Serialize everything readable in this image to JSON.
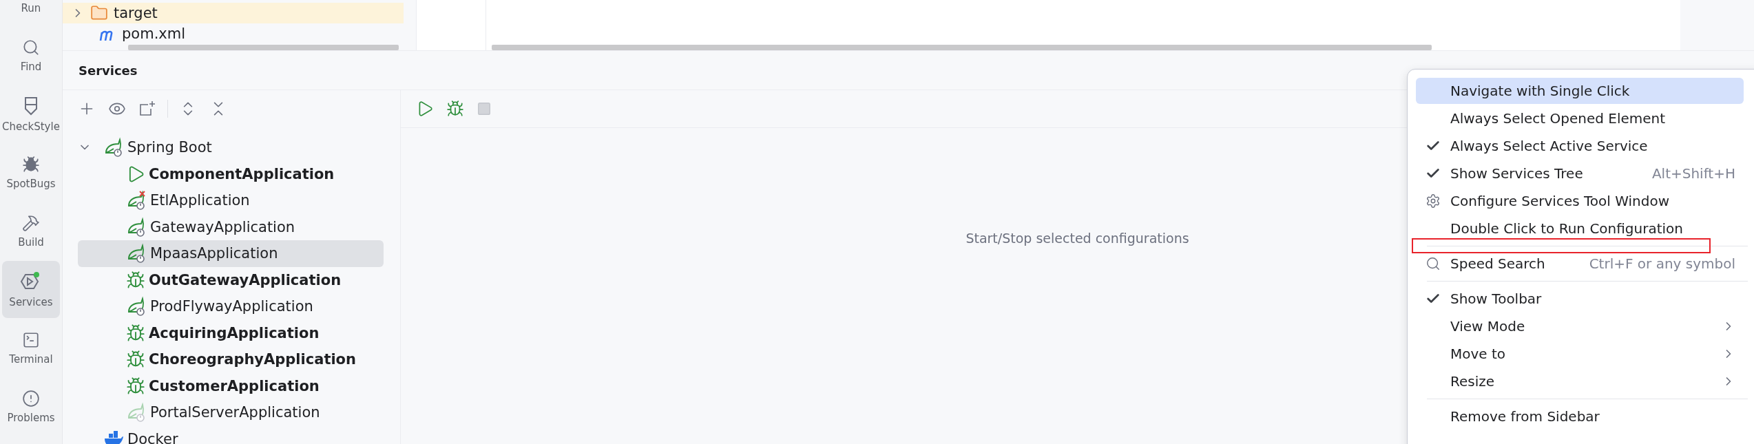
{
  "tool_stripe": [
    {
      "label": "Run",
      "selected": false
    },
    {
      "label": "Find",
      "selected": false
    },
    {
      "label": "CheckStyle",
      "selected": false
    },
    {
      "label": "SpotBugs",
      "selected": false
    },
    {
      "label": "Build",
      "selected": false
    },
    {
      "label": "Services",
      "selected": true
    },
    {
      "label": "Terminal",
      "selected": false
    },
    {
      "label": "Problems",
      "selected": false
    }
  ],
  "project_tree": [
    {
      "label": "target",
      "kind": "folder",
      "expanded": false,
      "selected": true
    },
    {
      "label": "pom.xml",
      "kind": "maven",
      "selected": false
    }
  ],
  "services": {
    "title": "Services",
    "tree": [
      {
        "label": "Spring Boot",
        "kind": "group",
        "expanded": true,
        "children": [
          {
            "label": "ComponentApplication",
            "kind": "running",
            "selected": false
          },
          {
            "label": "EtlApplication",
            "kind": "failed",
            "selected": false
          },
          {
            "label": "GatewayApplication",
            "kind": "stopped",
            "selected": false
          },
          {
            "label": "MpaasApplication",
            "kind": "stopped",
            "selected": true
          },
          {
            "label": "OutGatewayApplication",
            "kind": "debugging",
            "selected": false
          },
          {
            "label": "ProdFlywayApplication",
            "kind": "stopped",
            "selected": false
          },
          {
            "label": "AcquiringApplication",
            "kind": "debugging",
            "selected": false
          },
          {
            "label": "ChoreographyApplication",
            "kind": "debugging",
            "selected": false
          },
          {
            "label": "CustomerApplication",
            "kind": "debugging",
            "selected": false
          },
          {
            "label": "PortalServerApplication",
            "kind": "disabled",
            "selected": false
          }
        ]
      },
      {
        "label": "Docker",
        "kind": "docker"
      }
    ],
    "empty_text": "Start/Stop selected configurations"
  },
  "menu": [
    {
      "kind": "toggle",
      "label": "Navigate with Single Click",
      "checked": false,
      "selected": true
    },
    {
      "kind": "toggle",
      "label": "Always Select Opened Element",
      "checked": false,
      "selected": false
    },
    {
      "kind": "toggle",
      "label": "Always Select Active Service",
      "checked": true,
      "selected": false
    },
    {
      "kind": "toggle",
      "label": "Show Services Tree",
      "checked": true,
      "shortcut": "Alt+Shift+H",
      "selected": false
    },
    {
      "kind": "settings",
      "label": "Configure Services Tool Window",
      "selected": false
    },
    {
      "kind": "toggle",
      "label": "Double Click to Run Configuration",
      "checked": false,
      "selected": false,
      "annotated": true
    },
    {
      "kind": "separator"
    },
    {
      "kind": "search",
      "label": "Speed Search",
      "shortcut": "Ctrl+F or any symbol",
      "selected": false
    },
    {
      "kind": "separator"
    },
    {
      "kind": "toggle",
      "label": "Show Toolbar",
      "checked": true,
      "selected": false
    },
    {
      "kind": "submenu",
      "label": "View Mode",
      "selected": false
    },
    {
      "kind": "submenu",
      "label": "Move to",
      "selected": false
    },
    {
      "kind": "submenu",
      "label": "Resize",
      "selected": false
    },
    {
      "kind": "separator"
    },
    {
      "kind": "action",
      "label": "Remove from Sidebar",
      "selected": false
    }
  ]
}
